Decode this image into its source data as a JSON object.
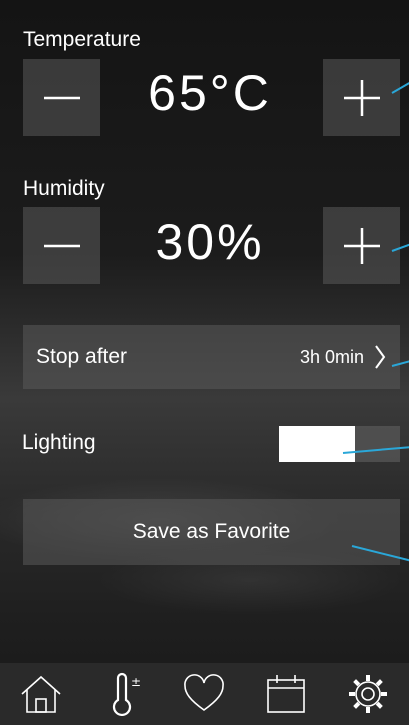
{
  "temperature": {
    "label": "Temperature",
    "value": "65°C",
    "decrease": "minus-icon",
    "increase": "plus-icon"
  },
  "humidity": {
    "label": "Humidity",
    "value": "30%",
    "decrease": "minus-icon",
    "increase": "plus-icon"
  },
  "stop_after": {
    "label": "Stop after",
    "value": "3h 0min",
    "icon": "chevron-right-icon"
  },
  "lighting": {
    "label": "Lighting",
    "level": 0.63
  },
  "favorite": {
    "label": "Save as Favorite"
  },
  "nav": {
    "items": [
      "home-icon",
      "thermometer-icon",
      "heart-icon",
      "calendar-icon",
      "settings-icon"
    ],
    "active": "thermometer-icon"
  },
  "colors": {
    "accent": "#2aa7d8",
    "button_bg": "#5a5a5a",
    "text": "#ffffff"
  }
}
